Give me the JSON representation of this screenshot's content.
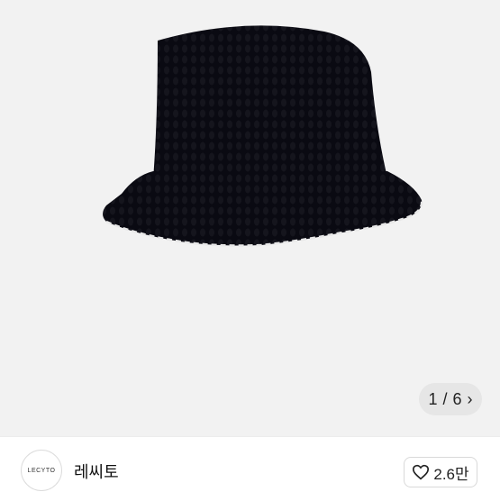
{
  "gallery": {
    "image_alt_icon": "bucket-hat-photo",
    "pager": {
      "current": "1",
      "separator": "/",
      "total": "6",
      "next_icon": "chevron-right-icon"
    }
  },
  "seller": {
    "avatar_text": "LECYTO",
    "name": "레씨토"
  },
  "like": {
    "icon": "heart-outline-icon",
    "count": "2.6만"
  },
  "colors": {
    "image_background": "#f2f2f2",
    "hat": "#0a0a12",
    "stitch": "#e8e8e8"
  }
}
